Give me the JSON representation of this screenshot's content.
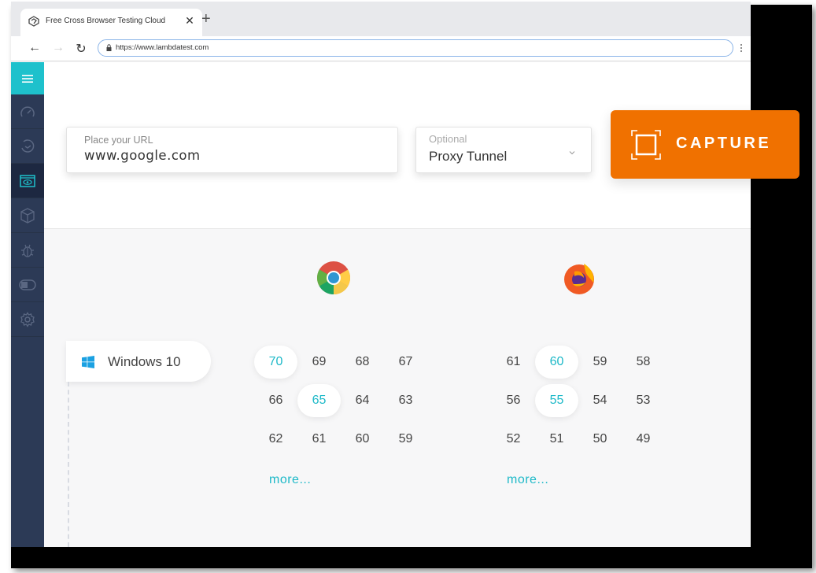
{
  "browser": {
    "tab_title": "Free Cross Browser Testing Cloud",
    "new_tab_symbol": "+",
    "close_symbol": "✕",
    "url": "https://www.lambdatest.com",
    "back_symbol": "←",
    "forward_symbol": "→",
    "reload_symbol": "↻"
  },
  "sidebar": {
    "items": [
      {
        "icon": "speedometer-icon",
        "label": "Dashboard"
      },
      {
        "icon": "clock-history-icon",
        "label": "History"
      },
      {
        "icon": "visual-eye-icon",
        "label": "Visual UI Testing",
        "active": true
      },
      {
        "icon": "box-icon",
        "label": "Integrations"
      },
      {
        "icon": "bug-icon",
        "label": "Issue Tracker"
      },
      {
        "icon": "toggle-icon",
        "label": "Toggle"
      },
      {
        "icon": "gear-icon",
        "label": "Settings"
      }
    ]
  },
  "form": {
    "url_label": "Place your URL",
    "url_value": "www.google.com",
    "proxy_label": "Optional",
    "proxy_value": "Proxy Tunnel"
  },
  "capture": {
    "label": "CAPTURE"
  },
  "os": {
    "label": "Windows 10"
  },
  "browsers": [
    {
      "name": "Chrome",
      "versions": [
        "70",
        "69",
        "68",
        "67",
        "66",
        "65",
        "64",
        "63",
        "62",
        "61",
        "60",
        "59"
      ],
      "selected": [
        "70",
        "65"
      ],
      "more_label": "more..."
    },
    {
      "name": "Firefox",
      "versions": [
        "61",
        "60",
        "59",
        "58",
        "56",
        "55",
        "54",
        "53",
        "52",
        "51",
        "50",
        "49"
      ],
      "selected": [
        "60",
        "55"
      ],
      "more_label": "more..."
    }
  ],
  "colors": {
    "accent": "#1ec1cc",
    "capture": "#f07100",
    "sidebar": "#2c3a56",
    "selected_text": "#1eb9c8"
  }
}
